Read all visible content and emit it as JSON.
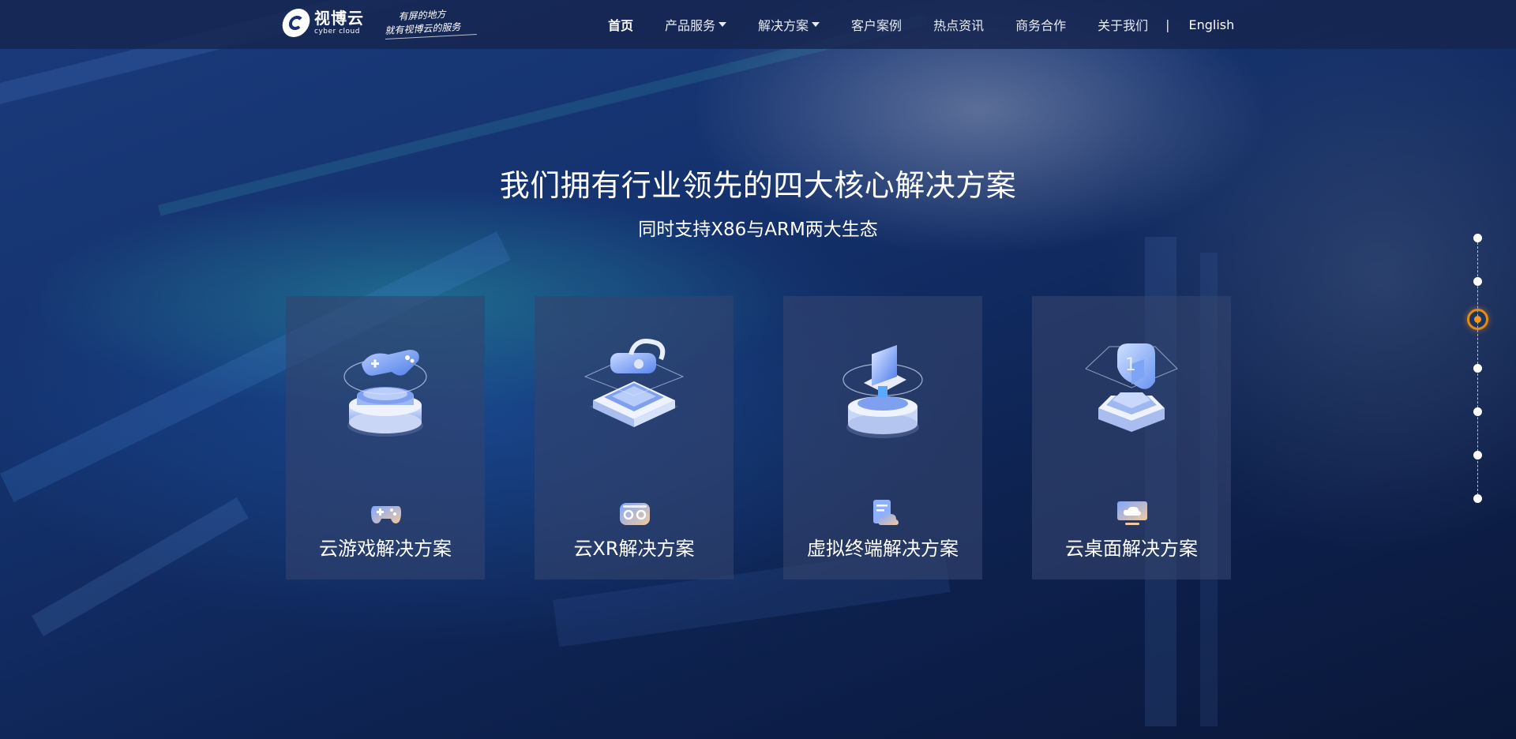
{
  "header": {
    "logo": {
      "name_cn": "视博云",
      "name_en": "cyber cloud"
    },
    "slogan": {
      "line1": "有屏的地方",
      "line2": "就有视博云的服务"
    },
    "nav": {
      "items": [
        {
          "label": "首页",
          "active": true,
          "dropdown": false
        },
        {
          "label": "产品服务",
          "active": false,
          "dropdown": true
        },
        {
          "label": "解决方案",
          "active": false,
          "dropdown": true
        },
        {
          "label": "客户案例",
          "active": false,
          "dropdown": false
        },
        {
          "label": "热点资讯",
          "active": false,
          "dropdown": false
        },
        {
          "label": "商务合作",
          "active": false,
          "dropdown": false
        },
        {
          "label": "关于我们",
          "active": false,
          "dropdown": false
        }
      ],
      "divider": "|",
      "language": "English"
    }
  },
  "hero": {
    "title": "我们拥有行业领先的四大核心解决方案",
    "subtitle": "同时支持X86与ARM两大生态"
  },
  "solutions": [
    {
      "label": "云游戏解决方案",
      "icon": "gamepad-icon"
    },
    {
      "label": "云XR解决方案",
      "icon": "vr-headset-icon"
    },
    {
      "label": "虚拟终端解决方案",
      "icon": "cloud-document-icon"
    },
    {
      "label": "云桌面解决方案",
      "icon": "cloud-monitor-icon"
    }
  ],
  "pager": {
    "total": 7,
    "active_index": 2
  },
  "colors": {
    "accent": "#f39a1b",
    "card_bg": "#34446e",
    "header_bg": "#16244e",
    "illustration_blue": "#6f9cf5"
  }
}
